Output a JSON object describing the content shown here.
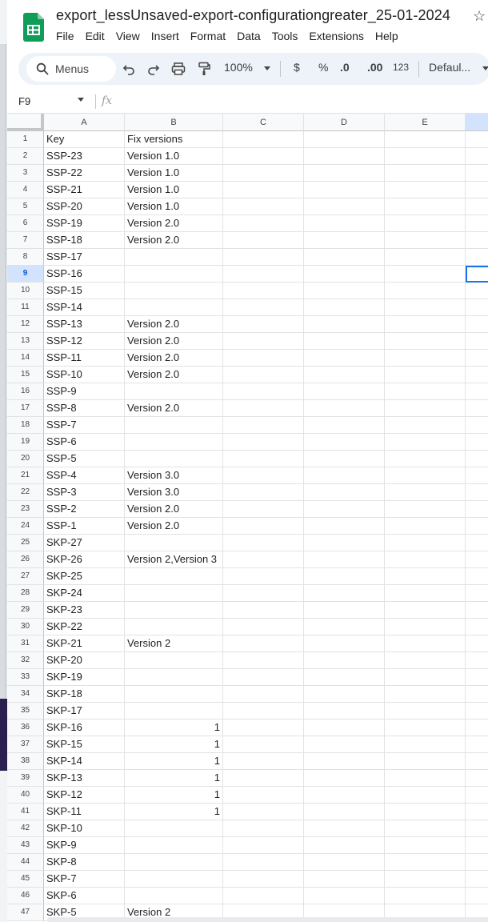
{
  "title": "export_lessUnsaved-export-configurationgreater_25-01-2024",
  "menu": [
    "File",
    "Edit",
    "View",
    "Insert",
    "Format",
    "Data",
    "Tools",
    "Extensions",
    "Help"
  ],
  "toolbar": {
    "search_label": "Menus",
    "zoom": "100%",
    "currency": "$",
    "percent": "%",
    "dec_decrease": ".0",
    "dec_increase": ".00",
    "number_format": "123",
    "font": "Defaul..."
  },
  "name_box": "F9",
  "fx_label": "fx",
  "columns": [
    "A",
    "B",
    "C",
    "D",
    "E"
  ],
  "selected_row": 9,
  "rows": [
    {
      "n": "1",
      "a": "Key",
      "b": "Fix versions"
    },
    {
      "n": "2",
      "a": "SSP-23",
      "b": "Version 1.0"
    },
    {
      "n": "3",
      "a": "SSP-22",
      "b": "Version 1.0"
    },
    {
      "n": "4",
      "a": "SSP-21",
      "b": "Version 1.0"
    },
    {
      "n": "5",
      "a": "SSP-20",
      "b": "Version 1.0"
    },
    {
      "n": "6",
      "a": "SSP-19",
      "b": "Version 2.0"
    },
    {
      "n": "7",
      "a": "SSP-18",
      "b": "Version 2.0"
    },
    {
      "n": "8",
      "a": "SSP-17",
      "b": ""
    },
    {
      "n": "9",
      "a": "SSP-16",
      "b": ""
    },
    {
      "n": "10",
      "a": "SSP-15",
      "b": ""
    },
    {
      "n": "11",
      "a": "SSP-14",
      "b": ""
    },
    {
      "n": "12",
      "a": "SSP-13",
      "b": "Version 2.0"
    },
    {
      "n": "13",
      "a": "SSP-12",
      "b": "Version 2.0"
    },
    {
      "n": "14",
      "a": "SSP-11",
      "b": "Version 2.0"
    },
    {
      "n": "15",
      "a": "SSP-10",
      "b": "Version 2.0"
    },
    {
      "n": "16",
      "a": "SSP-9",
      "b": ""
    },
    {
      "n": "17",
      "a": "SSP-8",
      "b": "Version 2.0"
    },
    {
      "n": "18",
      "a": "SSP-7",
      "b": ""
    },
    {
      "n": "19",
      "a": "SSP-6",
      "b": ""
    },
    {
      "n": "20",
      "a": "SSP-5",
      "b": ""
    },
    {
      "n": "21",
      "a": "SSP-4",
      "b": "Version 3.0"
    },
    {
      "n": "22",
      "a": "SSP-3",
      "b": "Version 3.0"
    },
    {
      "n": "23",
      "a": "SSP-2",
      "b": "Version 2.0"
    },
    {
      "n": "24",
      "a": "SSP-1",
      "b": "Version 2.0"
    },
    {
      "n": "25",
      "a": "SKP-27",
      "b": ""
    },
    {
      "n": "26",
      "a": "SKP-26",
      "b": "Version 2,Version 3"
    },
    {
      "n": "27",
      "a": "SKP-25",
      "b": ""
    },
    {
      "n": "28",
      "a": "SKP-24",
      "b": ""
    },
    {
      "n": "29",
      "a": "SKP-23",
      "b": ""
    },
    {
      "n": "30",
      "a": "SKP-22",
      "b": ""
    },
    {
      "n": "31",
      "a": "SKP-21",
      "b": "Version 2"
    },
    {
      "n": "32",
      "a": "SKP-20",
      "b": ""
    },
    {
      "n": "33",
      "a": "SKP-19",
      "b": ""
    },
    {
      "n": "34",
      "a": "SKP-18",
      "b": ""
    },
    {
      "n": "35",
      "a": "SKP-17",
      "b": ""
    },
    {
      "n": "36",
      "a": "SKP-16",
      "b": "1",
      "num": true
    },
    {
      "n": "37",
      "a": "SKP-15",
      "b": "1",
      "num": true
    },
    {
      "n": "38",
      "a": "SKP-14",
      "b": "1",
      "num": true
    },
    {
      "n": "39",
      "a": "SKP-13",
      "b": "1",
      "num": true
    },
    {
      "n": "40",
      "a": "SKP-12",
      "b": "1",
      "num": true
    },
    {
      "n": "41",
      "a": "SKP-11",
      "b": "1",
      "num": true
    },
    {
      "n": "42",
      "a": "SKP-10",
      "b": ""
    },
    {
      "n": "43",
      "a": "SKP-9",
      "b": ""
    },
    {
      "n": "44",
      "a": "SKP-8",
      "b": ""
    },
    {
      "n": "45",
      "a": "SKP-7",
      "b": ""
    },
    {
      "n": "46",
      "a": "SKP-6",
      "b": ""
    },
    {
      "n": "47",
      "a": "SKP-5",
      "b": "Version 2"
    }
  ]
}
